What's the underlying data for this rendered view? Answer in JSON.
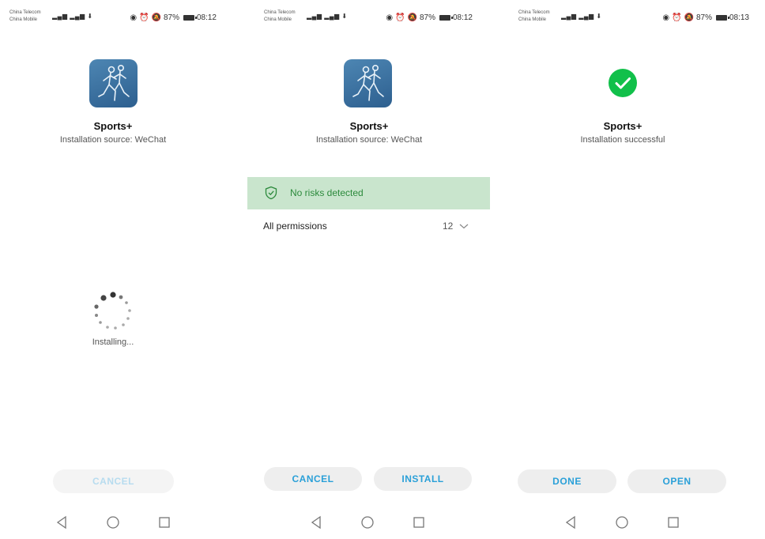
{
  "status_bar": {
    "carrier1": "China Telecom",
    "carrier2": "China Mobile",
    "signal": "4G",
    "battery": "87%",
    "times": [
      "08:12",
      "08:12",
      "08:13"
    ]
  },
  "app": {
    "name": "Sports+",
    "source": "Installation source: WeChat"
  },
  "screen1": {
    "status": "Installing...",
    "cancel_label": "CANCEL"
  },
  "screen2": {
    "risk_label": "No risks detected",
    "permissions_label": "All permissions",
    "permissions_count": "12",
    "cancel_label": "CANCEL",
    "install_label": "INSTALL"
  },
  "screen3": {
    "status": "Installation successful",
    "done_label": "DONE",
    "open_label": "OPEN"
  },
  "colors": {
    "accent": "#2aa0d8",
    "success": "#11c04a",
    "risk_bg": "#c9e5cd",
    "risk_text": "#2c8a3c",
    "button_bg": "#eeeeee"
  },
  "icons": [
    "eye-icon",
    "alarm-icon",
    "mute-icon",
    "battery-icon",
    "download-icon",
    "shield-check-icon",
    "chevron-down-icon",
    "back-icon",
    "home-icon",
    "recents-icon",
    "checkmark-icon"
  ]
}
